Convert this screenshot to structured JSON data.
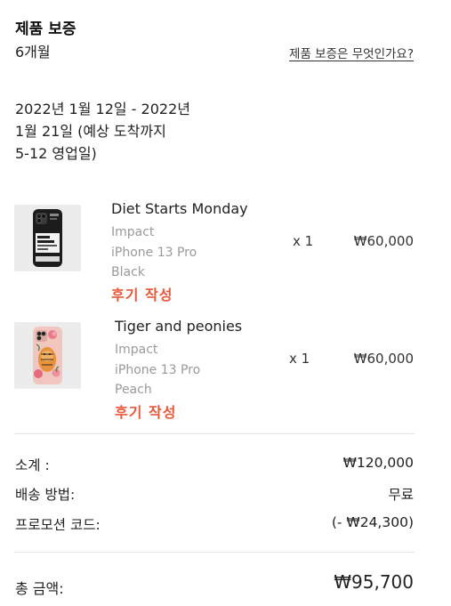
{
  "warranty": {
    "title": "제품 보증",
    "value": "6개월",
    "link": "제품 보증은 무엇인가요?"
  },
  "delivery": {
    "line1": "2022년 1월 12일 - 2022년",
    "line2": "1월 21일 (예상 도착까지",
    "line3": "5-12 영업일)"
  },
  "items": [
    {
      "name": "Diet Starts Monday",
      "type": "Impact",
      "model": "iPhone 13 Pro",
      "color": "Black",
      "review": "후기 작성",
      "qty": "x 1",
      "price": "₩60,000"
    },
    {
      "name": "Tiger and peonies",
      "type": "Impact",
      "model": "iPhone 13 Pro",
      "color": "Peach",
      "review": "후기 작성",
      "qty": "x 1",
      "price": "₩60,000"
    }
  ],
  "summary": {
    "subtotal_label": "소계 :",
    "subtotal_value": "₩120,000",
    "shipping_label": "배송 방법:",
    "shipping_value": "무료",
    "promo_label": "프로모션 코드:",
    "promo_value": "(- ₩24,300)",
    "total_label": "총 금액:",
    "total_value": "₩95,700"
  },
  "colors": {
    "accent": "#e8593c",
    "muted": "#9a9a9a",
    "divider": "#e2e2e2"
  }
}
